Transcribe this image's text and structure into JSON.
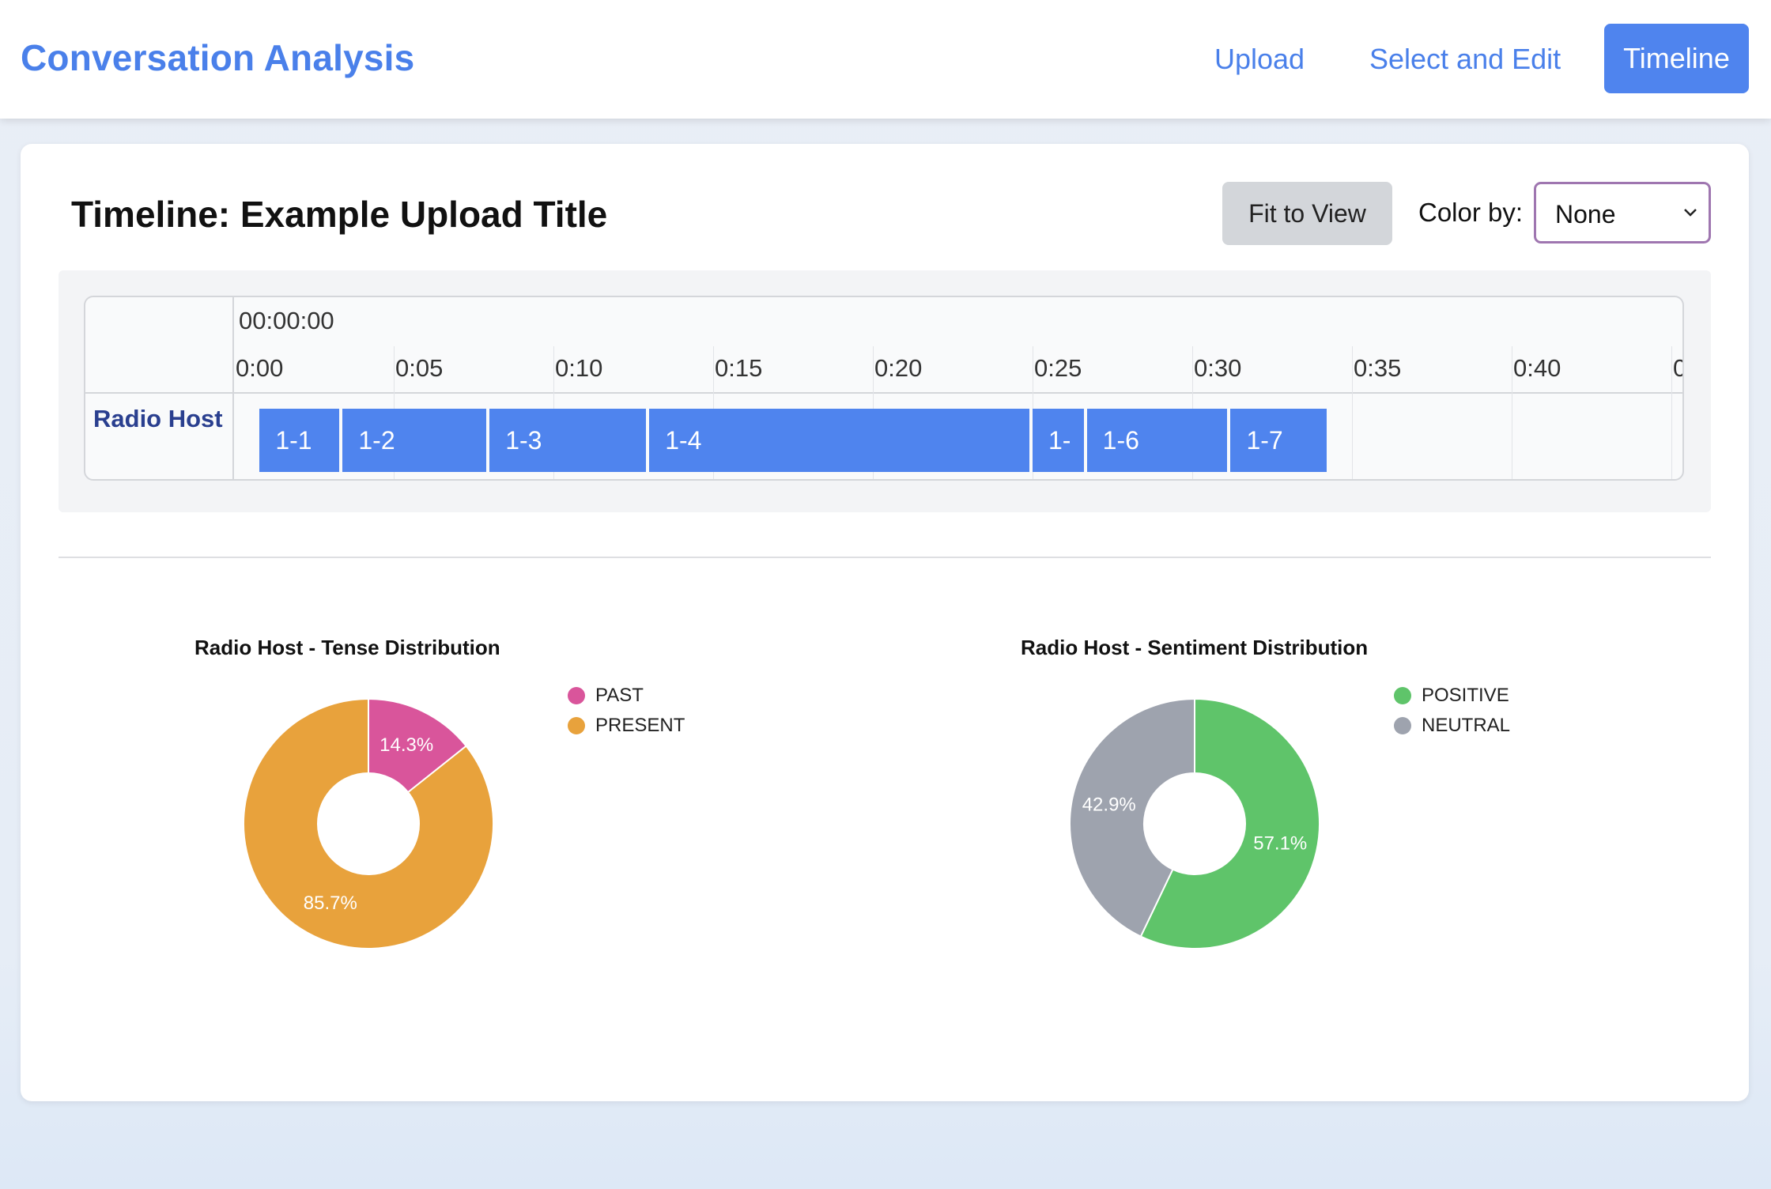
{
  "header": {
    "app_title": "Conversation Analysis",
    "nav": {
      "upload": "Upload",
      "select_edit": "Select and Edit",
      "timeline": "Timeline"
    }
  },
  "page": {
    "title": "Timeline: Example Upload Title",
    "fit_button": "Fit to View",
    "color_by_label": "Color by:",
    "color_by_value": "None"
  },
  "timeline": {
    "start_time": "00:00:00",
    "ticks": [
      "0:00",
      "0:05",
      "0:10",
      "0:15",
      "0:20",
      "0:25",
      "0:30",
      "0:35",
      "0:40",
      "0"
    ],
    "track": {
      "label": "Radio Host",
      "segments": [
        {
          "label": "1-1",
          "start_s": 0.8,
          "end_s": 3.3
        },
        {
          "label": "1-2",
          "start_s": 3.4,
          "end_s": 7.9
        },
        {
          "label": "1-3",
          "start_s": 8.0,
          "end_s": 12.9
        },
        {
          "label": "1-4",
          "start_s": 13.0,
          "end_s": 24.9
        },
        {
          "label": "1-",
          "start_s": 25.0,
          "end_s": 26.6
        },
        {
          "label": "1-6",
          "start_s": 26.7,
          "end_s": 31.1
        },
        {
          "label": "1-7",
          "start_s": 31.2,
          "end_s": 34.2
        }
      ],
      "color": "#4f84ee"
    }
  },
  "chart_data": [
    {
      "type": "pie",
      "title": "Radio Host - Tense Distribution",
      "categories": [
        "PAST",
        "PRESENT"
      ],
      "values": [
        14.3,
        85.7
      ],
      "value_labels": [
        "14.3%",
        "85.7%"
      ],
      "colors": [
        "#d9559b",
        "#e8a23c"
      ],
      "legend": "right"
    },
    {
      "type": "pie",
      "title": "Radio Host - Sentiment Distribution",
      "categories": [
        "POSITIVE",
        "NEUTRAL"
      ],
      "values": [
        57.1,
        42.9
      ],
      "value_labels": [
        "57.1%",
        "42.9%"
      ],
      "colors": [
        "#5fc46a",
        "#9ea3ae"
      ],
      "legend": "right"
    }
  ]
}
